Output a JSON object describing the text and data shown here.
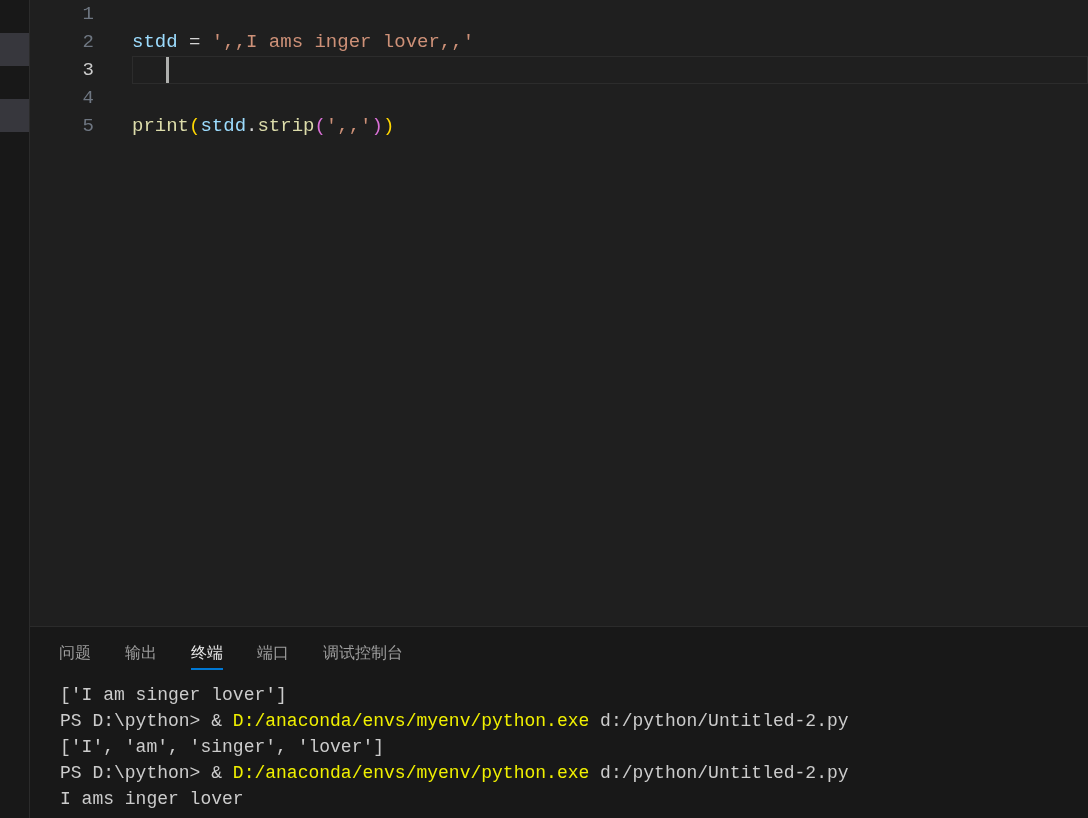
{
  "sidebar": {
    "rows": [
      {
        "selected": false
      },
      {
        "selected": true
      },
      {
        "selected": false
      },
      {
        "selected": true
      }
    ]
  },
  "editor": {
    "lines": [
      {
        "number": "1",
        "current": false
      },
      {
        "number": "2",
        "current": false,
        "tokens": [
          {
            "kind": "variable",
            "text": "stdd"
          },
          {
            "kind": "operator",
            "text": " = "
          },
          {
            "kind": "string",
            "text": "',,I ams inger lover,,'"
          }
        ]
      },
      {
        "number": "3",
        "current": true
      },
      {
        "number": "4",
        "current": false
      },
      {
        "number": "5",
        "current": false,
        "tokens": [
          {
            "kind": "function",
            "text": "print"
          },
          {
            "kind": "bracket1",
            "text": "("
          },
          {
            "kind": "variable",
            "text": "stdd"
          },
          {
            "kind": "punct",
            "text": "."
          },
          {
            "kind": "function",
            "text": "strip"
          },
          {
            "kind": "bracket2",
            "text": "("
          },
          {
            "kind": "string",
            "text": "',,'"
          },
          {
            "kind": "bracket2",
            "text": ")"
          },
          {
            "kind": "bracket1",
            "text": ")"
          }
        ]
      }
    ]
  },
  "panel": {
    "tabs": [
      {
        "label": "问题",
        "selected": false
      },
      {
        "label": "输出",
        "selected": false
      },
      {
        "label": "终端",
        "selected": true
      },
      {
        "label": "端口",
        "selected": false
      },
      {
        "label": "调试控制台",
        "selected": false
      }
    ],
    "terminal_lines": [
      [
        {
          "kind": "plain",
          "text": "['I am singer lover']"
        }
      ],
      [
        {
          "kind": "plain",
          "text": "PS D:\\python> & "
        },
        {
          "kind": "path",
          "text": "D:/anaconda/envs/myenv/python.exe"
        },
        {
          "kind": "plain",
          "text": " d:/python/Untitled-2.py"
        }
      ],
      [
        {
          "kind": "plain",
          "text": "['I', 'am', 'singer', 'lover']"
        }
      ],
      [
        {
          "kind": "plain",
          "text": "PS D:\\python> & "
        },
        {
          "kind": "path",
          "text": "D:/anaconda/envs/myenv/python.exe"
        },
        {
          "kind": "plain",
          "text": " d:/python/Untitled-2.py"
        }
      ],
      [
        {
          "kind": "plain",
          "text": "I ams inger lover"
        }
      ]
    ]
  }
}
